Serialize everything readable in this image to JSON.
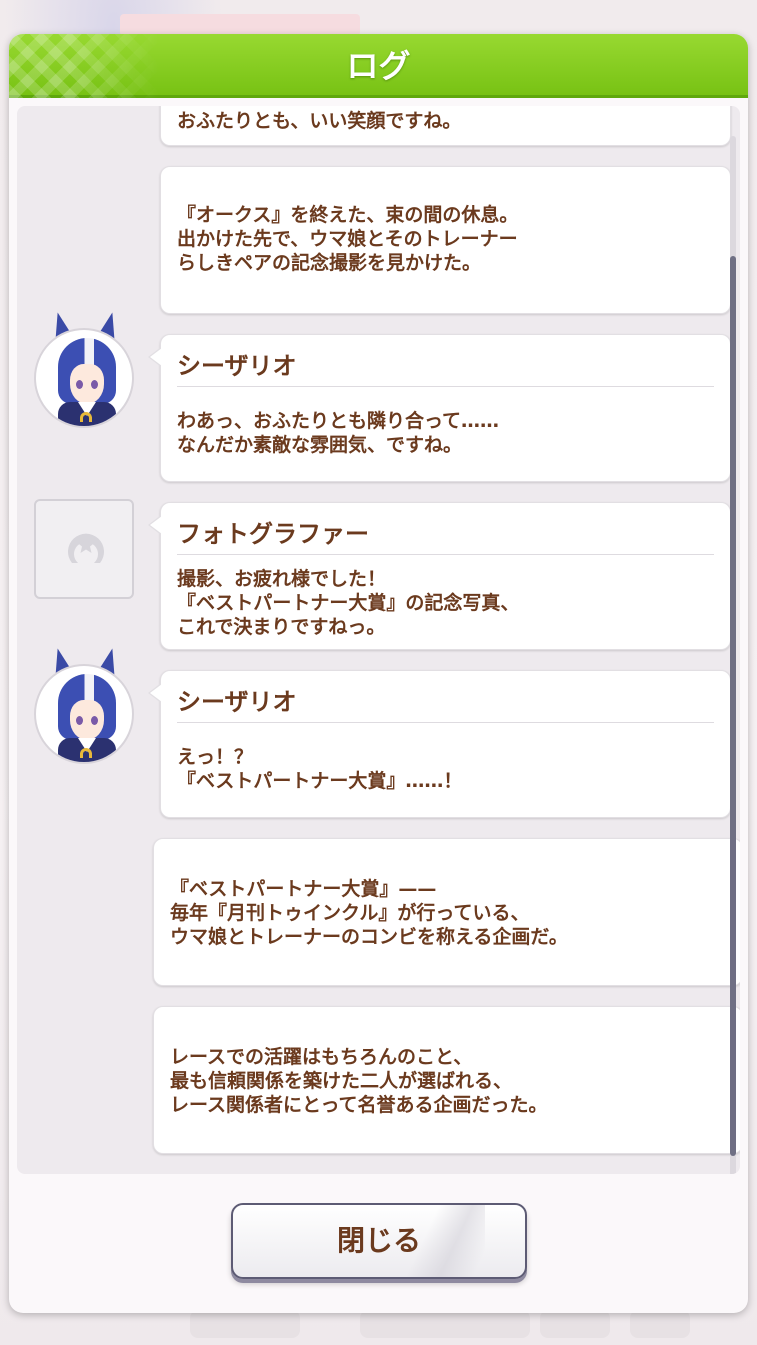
{
  "dialog": {
    "title": "ログ",
    "close_label": "閉じる"
  },
  "log": {
    "entries": [
      {
        "type": "narration",
        "text": "おふたりとも、いい笑顔ですね。"
      },
      {
        "type": "narration",
        "text": "『オークス』を終えた、束の間の休息。\n出かけた先で、ウマ娘とそのトレーナー\nらしきペアの記念撮影を見かけた。"
      },
      {
        "type": "dialogue",
        "speaker": "シーザリオ",
        "avatar": "character-portrait-icon",
        "text": "わあっ、おふたりとも隣り合って……\nなんだか素敵な雰囲気、ですね。"
      },
      {
        "type": "dialogue",
        "speaker": "フォトグラファー",
        "avatar": "no-portrait-placeholder-icon",
        "text": "撮影、お疲れ様でした！\n『ベストパートナー大賞』の記念写真、\nこれで決まりですねっ。"
      },
      {
        "type": "dialogue",
        "speaker": "シーザリオ",
        "avatar": "character-portrait-icon",
        "text": "えっ！？\n『ベストパートナー大賞』……！"
      },
      {
        "type": "narration",
        "text": "『ベストパートナー大賞』——\n毎年『月刊トゥインクル』が行っている、\nウマ娘とトレーナーのコンビを称える企画だ。"
      },
      {
        "type": "narration",
        "text": "レースでの活躍はもちろんのこと、\n最も信頼関係を築けた二人が選ばれる、\nレース関係者にとって名誉ある企画だった。"
      }
    ]
  },
  "colors": {
    "header_green": "#78c214",
    "text_brown": "#6b3a1e",
    "panel": "#fbf8fa"
  }
}
